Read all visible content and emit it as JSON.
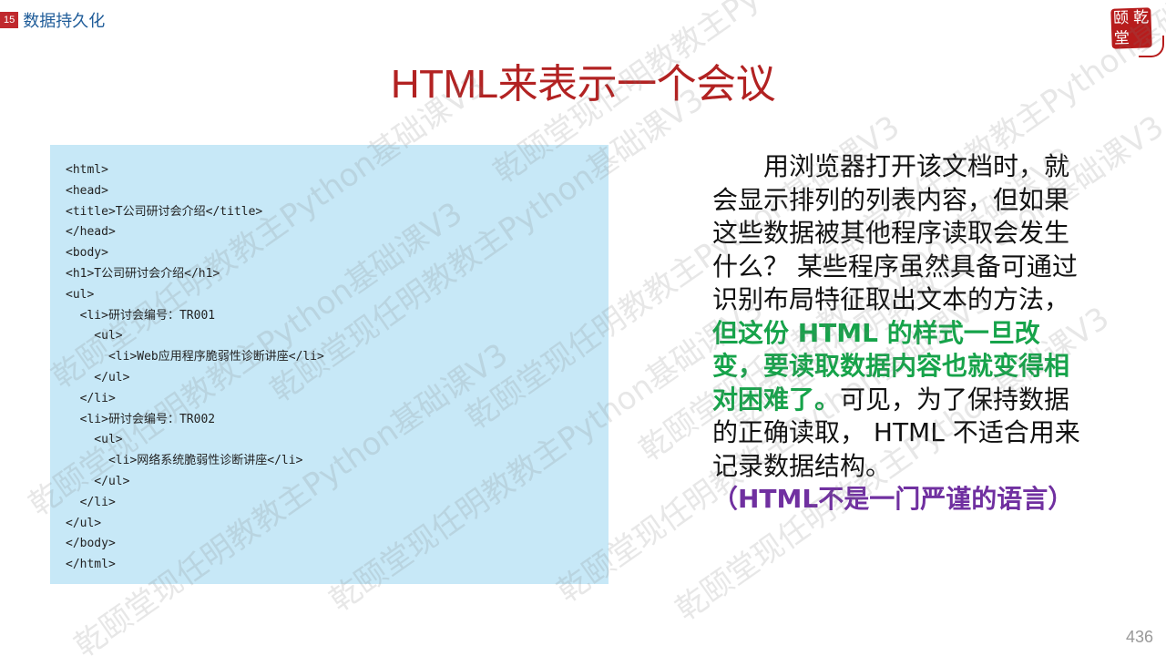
{
  "section": {
    "number": "15",
    "title": "数据持久化"
  },
  "logo": {
    "chars": [
      "颐",
      "乾",
      "堂",
      ""
    ]
  },
  "slide": {
    "title": "HTML来表示一个会议"
  },
  "code": {
    "lines": [
      "<html>",
      "<head>",
      "<title>T公司研讨会介绍</title>",
      "</head>",
      "<body>",
      "<h1>T公司研讨会介绍</h1>",
      "<ul>",
      "  <li>研讨会编号：TR001",
      "    <ul>",
      "      <li>Web应用程序脆弱性诊断讲座</li>",
      "    </ul>",
      "  </li>",
      "  <li>研讨会编号：TR002",
      "    <ul>",
      "      <li>网络系统脆弱性诊断讲座</li>",
      "    </ul>",
      "  </li>",
      "</ul>",
      "</body>",
      "</html>"
    ]
  },
  "body": {
    "part1": "用浏览器打开该文档时，就会显示排列的列表内容，但如果这些数据被其他程序读取会发生什么？ 某些程序虽然具备可通过识别布局特征取出文本的方法，",
    "part2_highlight": "但这份 HTML 的样式一旦改变，要读取数据内容也就变得相对困难了。",
    "part3": "可见，为了保持数据的正确读取， HTML 不适合用来记录数据结构。",
    "part4_note": "（HTML不是一门严谨的语言）"
  },
  "watermark": {
    "text": "乾颐堂现任明教教主Python基础课V3"
  },
  "page": {
    "number": "436"
  },
  "colors": {
    "title": "#b22222",
    "section_badge": "#c0282d",
    "section_text": "#1f5c99",
    "code_bg": "#c7e8f7",
    "highlight_green": "#16a34a",
    "highlight_purple": "#7030a0"
  }
}
